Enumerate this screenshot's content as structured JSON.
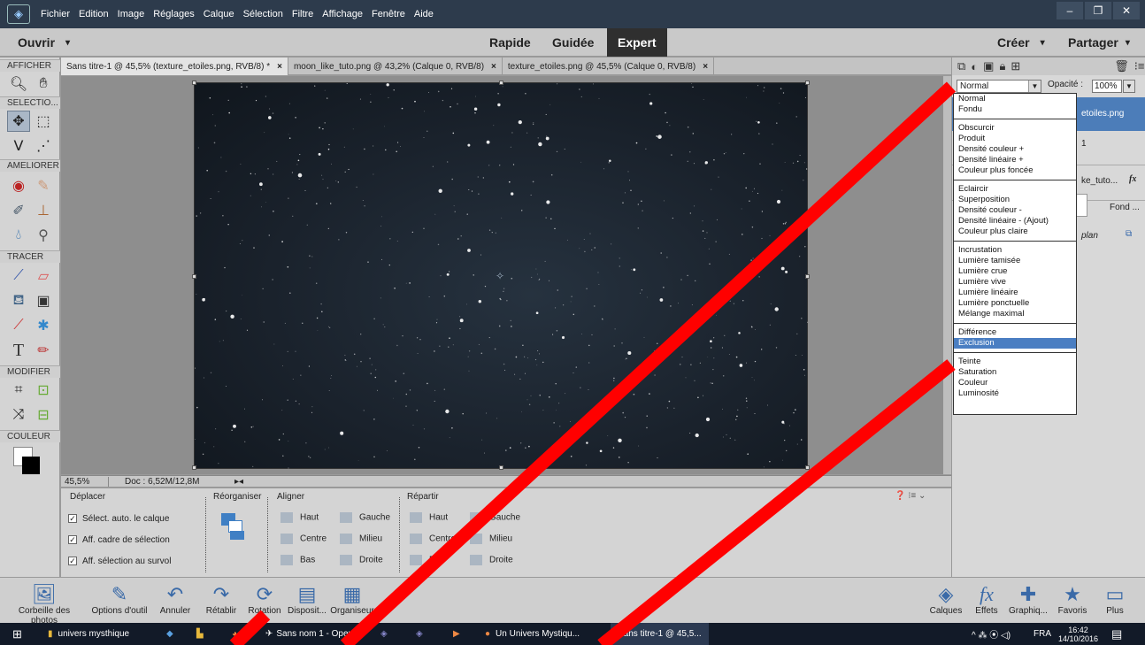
{
  "menubar": {
    "items": [
      "Fichier",
      "Edition",
      "Image",
      "Réglages",
      "Calque",
      "Sélection",
      "Filtre",
      "Affichage",
      "Fenêtre",
      "Aide"
    ]
  },
  "modebar": {
    "open_label": "Ouvrir",
    "modes": [
      "Rapide",
      "Guidée",
      "Expert"
    ],
    "active_mode": "Expert",
    "create_label": "Créer",
    "share_label": "Partager"
  },
  "toolbox": {
    "sections": [
      "AFFICHER",
      "SELECTIO...",
      "AMELIORER",
      "TRACER",
      "MODIFIER",
      "COULEUR"
    ]
  },
  "tabs": [
    {
      "label": "Sans titre-1 @ 45,5% (texture_etoiles.png, RVB/8) *",
      "active": true
    },
    {
      "label": "moon_like_tuto.png @ 43,2% (Calque 0, RVB/8)",
      "active": false
    },
    {
      "label": "texture_etoiles.png @ 45,5% (Calque 0, RVB/8)",
      "active": false
    }
  ],
  "status": {
    "zoom": "45,5%",
    "doc": "Doc : 6,52M/12,8M"
  },
  "options": {
    "tool_name": "Déplacer",
    "checkboxes": [
      "Sélect. auto. le calque",
      "Aff. cadre de sélection",
      "Aff. sélection au survol"
    ],
    "reorganiser": "Réorganiser",
    "aligner": "Aligner",
    "repartir": "Répartir",
    "align_col1": [
      "Haut",
      "Centre",
      "Bas"
    ],
    "align_col2": [
      "Gauche",
      "Milieu",
      "Droite"
    ],
    "rep_col1": [
      "Haut",
      "Centre",
      "Bas"
    ],
    "rep_col2": [
      "Gauche",
      "Milieu",
      "Droite"
    ]
  },
  "layers_panel": {
    "blend_mode": "Normal",
    "opacity_label": "Opacité :",
    "opacity_value": "100%",
    "layer1": "etoiles.png",
    "layer2": "ke_tuto...",
    "fx": "fx",
    "fond": "Fond ...",
    "plan": "plan"
  },
  "blend_modes": [
    [
      "Normal",
      "Fondu"
    ],
    [
      "Obscurcir",
      "Produit",
      "Densité couleur +",
      "Densité linéaire +",
      "Couleur plus foncée"
    ],
    [
      "Eclaircir",
      "Superposition",
      "Densité couleur -",
      "Densité linéaire - (Ajout)",
      "Couleur plus claire"
    ],
    [
      "Incrustation",
      "Lumière tamisée",
      "Lumière crue",
      "Lumière vive",
      "Lumière linéaire",
      "Lumière ponctuelle",
      "Mélange maximal"
    ],
    [
      "Différence",
      "Exclusion"
    ],
    [
      "Teinte",
      "Saturation",
      "Couleur",
      "Luminosité"
    ]
  ],
  "highlighted_blend": "Exclusion",
  "bottombar": {
    "left": [
      "Corbeille des photos",
      "Options d'outil",
      "Annuler",
      "Rétablir",
      "Rotation",
      "Disposit...",
      "Organiseur"
    ],
    "right": [
      "Calques",
      "Effets",
      "Graphiq...",
      "Favoris",
      "Plus"
    ]
  },
  "taskbar": {
    "items": [
      "univers mysthique",
      "Sans nom 1 - Open...",
      "Un Univers Mystiqu...",
      "Sans titre-1 @ 45,5..."
    ],
    "lang": "FRA",
    "time": "16:42",
    "date": "14/10/2016"
  },
  "colors": {
    "accent": "#4a7ec2",
    "titlebar": "#2d3b4c",
    "overlay_line": "#ff0000"
  }
}
